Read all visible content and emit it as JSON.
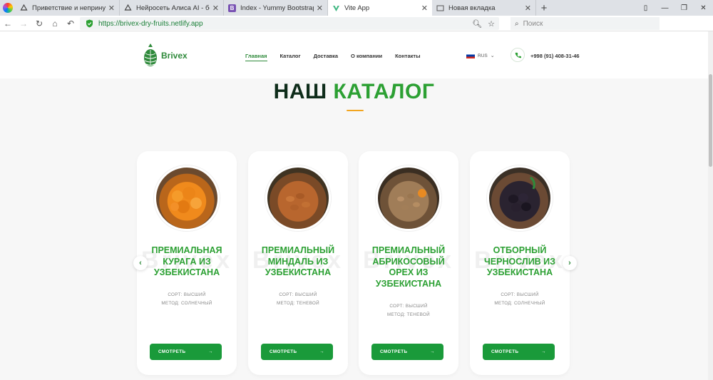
{
  "browser": {
    "tabs": [
      {
        "title": "Приветствие и непринуждё",
        "icon": "cloud-icon",
        "active": false
      },
      {
        "title": "Нейросеть Алиса AI - беспл",
        "icon": "cloud-icon",
        "active": false
      },
      {
        "title": "Index - Yummy Bootstrap Ten",
        "icon": "bootstrap-icon",
        "active": false
      },
      {
        "title": "Vite App",
        "icon": "vite-icon",
        "active": true
      },
      {
        "title": "Новая вкладка",
        "icon": "page-icon",
        "active": false
      }
    ],
    "url": "https://brivex-dry-fruits.netlify.app",
    "search_placeholder": "Поиск"
  },
  "site": {
    "logo": "Brivex",
    "nav": [
      "Главная",
      "Каталог",
      "Доставка",
      "О компании",
      "Контакты"
    ],
    "lang": "RUS",
    "phone": "+998 (91) 408-31-46",
    "title_part1": "НАШ",
    "title_part2": "КАТАЛОГ",
    "watermark": "Brivex",
    "products": [
      {
        "name": "ПРЕМИАЛЬНАЯ КУРАГА ИЗ УЗБЕКИСТАНА",
        "sort": "СОРТ: ВЫСШИЙ",
        "method": "МЕТОД: СОЛНЕЧНЫЙ",
        "button": "СМОТРЕТЬ",
        "image": "apricot"
      },
      {
        "name": "ПРЕМИАЛЬНЫЙ МИНДАЛЬ ИЗ УЗБЕКИСТАНА",
        "sort": "СОРТ: ВЫСШИЙ",
        "method": "МЕТОД: ТЕНЕВОЙ",
        "button": "СМОТРЕТЬ",
        "image": "almond"
      },
      {
        "name": "ПРЕМИАЛЬНЫЙ АБРИКОСОВЫЙ ОРЕХ ИЗ УЗБЕКИСТАНА",
        "sort": "СОРТ: ВЫСШИЙ",
        "method": "МЕТОД: ТЕНЕВОЙ",
        "button": "СМОТРЕТЬ",
        "image": "apricot-kernel"
      },
      {
        "name": "ОТБОРНЫЙ ЧЕРНОСЛИВ ИЗ УЗБЕКИСТАНА",
        "sort": "СОРТ: ВЫСШИЙ",
        "method": "МЕТОД: СОЛНЕЧНЫЙ",
        "button": "СМОТРЕТЬ",
        "image": "prune"
      }
    ]
  },
  "colors": {
    "brand_green": "#2ca033",
    "button_green": "#1a9a3a",
    "title_dark": "#0e2c1a",
    "accent_orange": "#f2a51f"
  }
}
